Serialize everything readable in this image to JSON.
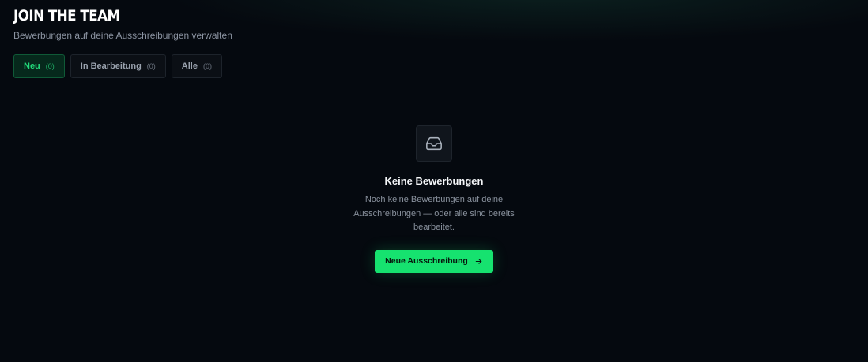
{
  "header": {
    "title": "JOIN THE TEAM",
    "subtitle": "Bewerbungen auf deine Ausschreibungen verwalten"
  },
  "tabs": [
    {
      "label": "Neu",
      "count": "(0)",
      "active": true
    },
    {
      "label": "In Bearbeitung",
      "count": "(0)",
      "active": false
    },
    {
      "label": "Alle",
      "count": "(0)",
      "active": false
    }
  ],
  "empty_state": {
    "icon": "inbox-icon",
    "title": "Keine Bewerbungen",
    "text": "Noch keine Bewerbungen auf deine Ausschreibungen — oder alle sind bereits bearbeitet.",
    "button_label": "Neue Ausschreibung",
    "button_icon": "arrow-right-icon"
  },
  "colors": {
    "background": "#05090f",
    "accent": "#16e26f",
    "active_tab_text": "#22d97a"
  }
}
